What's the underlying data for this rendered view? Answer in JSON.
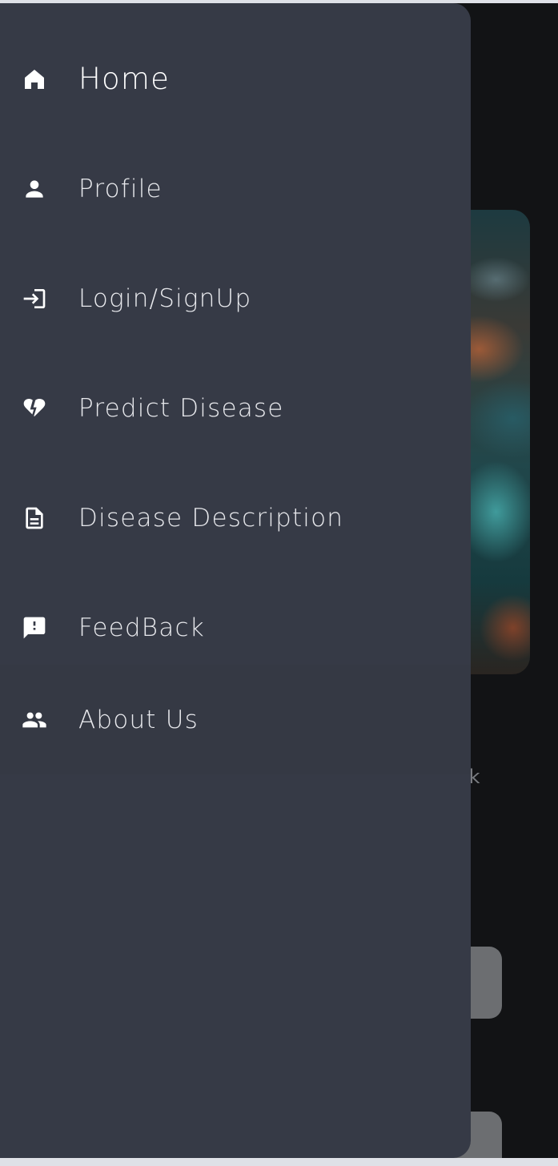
{
  "background": {
    "partial_text": "ark"
  },
  "drawer": {
    "items": [
      {
        "label": "Home",
        "icon": "home-icon"
      },
      {
        "label": "Profile",
        "icon": "person-icon"
      },
      {
        "label": "Login/SignUp",
        "icon": "login-icon"
      },
      {
        "label": "Predict Disease",
        "icon": "heart-broken-icon"
      },
      {
        "label": "Disease Description",
        "icon": "document-icon"
      },
      {
        "label": "FeedBack",
        "icon": "feedback-icon"
      },
      {
        "label": "About Us",
        "icon": "people-icon"
      }
    ]
  },
  "colors": {
    "drawer_bg": "#363a46",
    "screen_bg": "#121315",
    "text": "#e7e8ec"
  }
}
